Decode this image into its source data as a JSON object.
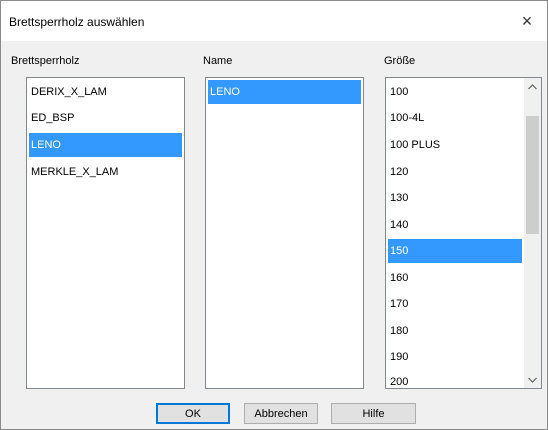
{
  "window": {
    "title": "Brettsperrholz auswählen",
    "close_glyph": "×"
  },
  "columns": {
    "brettsperrholz": {
      "label": "Brettsperrholz",
      "items": [
        "DERIX_X_LAM",
        "ED_BSP",
        "LENO",
        "MERKLE_X_LAM"
      ],
      "selected": "LENO"
    },
    "name": {
      "label": "Name",
      "items": [
        "LENO"
      ],
      "selected": "LENO"
    },
    "groesse": {
      "label": "Größe",
      "items": [
        "100",
        "100-4L",
        "100 PLUS",
        "120",
        "130",
        "140",
        "150",
        "160",
        "170",
        "180",
        "190",
        "200"
      ],
      "selected": "150"
    }
  },
  "buttons": {
    "ok": "OK",
    "cancel": "Abbrechen",
    "help": "Hilfe"
  },
  "colors": {
    "selection": "#3399ff",
    "default_button_border": "#0078d7"
  }
}
